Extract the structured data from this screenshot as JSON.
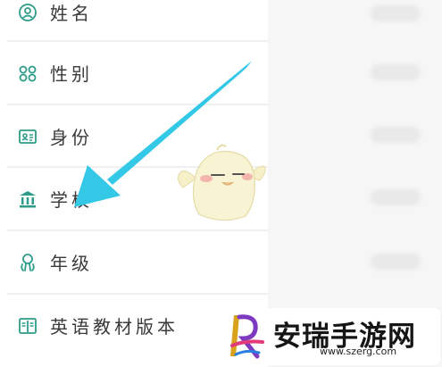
{
  "profile_fields": [
    {
      "label": "姓名",
      "icon": "user-icon"
    },
    {
      "label": "性别",
      "icon": "gender-icon"
    },
    {
      "label": "身份",
      "icon": "id-card-icon"
    },
    {
      "label": "学校",
      "icon": "school-icon"
    },
    {
      "label": "年级",
      "icon": "grade-icon"
    },
    {
      "label": "英语教材版本",
      "icon": "textbook-icon"
    }
  ],
  "watermark": {
    "title": "安瑞手游网",
    "url": "www.szerg.com"
  },
  "colors": {
    "icon_green": "#2e9c8a",
    "arrow": "#33c8e6",
    "text": "#3a3a3a"
  }
}
